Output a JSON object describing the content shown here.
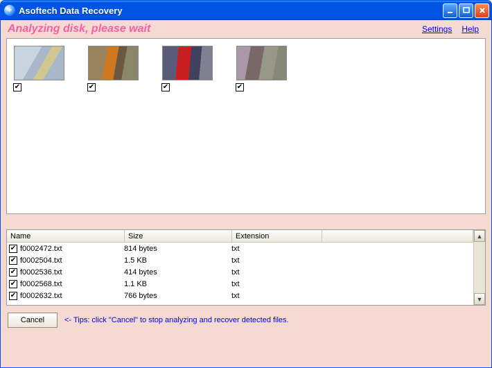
{
  "window": {
    "title": "Asoftech Data Recovery"
  },
  "status": "Analyzing disk, please wait",
  "links": {
    "settings": "Settings",
    "help": "Help"
  },
  "thumbs": [
    {
      "checked": true
    },
    {
      "checked": true
    },
    {
      "checked": true
    },
    {
      "checked": true
    }
  ],
  "list": {
    "headers": {
      "name": "Name",
      "size": "Size",
      "extension": "Extension"
    },
    "rows": [
      {
        "name": "f0002472.txt",
        "size": "814 bytes",
        "ext": "txt",
        "checked": true
      },
      {
        "name": "f0002504.txt",
        "size": "1.5 KB",
        "ext": "txt",
        "checked": true
      },
      {
        "name": "f0002536.txt",
        "size": "414 bytes",
        "ext": "txt",
        "checked": true
      },
      {
        "name": "f0002568.txt",
        "size": "1.1 KB",
        "ext": "txt",
        "checked": true
      },
      {
        "name": "f0002632.txt",
        "size": "766 bytes",
        "ext": "txt",
        "checked": true
      }
    ]
  },
  "footer": {
    "cancel": "Cancel",
    "tip": "<- Tips: click \"Cancel\" to stop analyzing and recover detected files."
  }
}
